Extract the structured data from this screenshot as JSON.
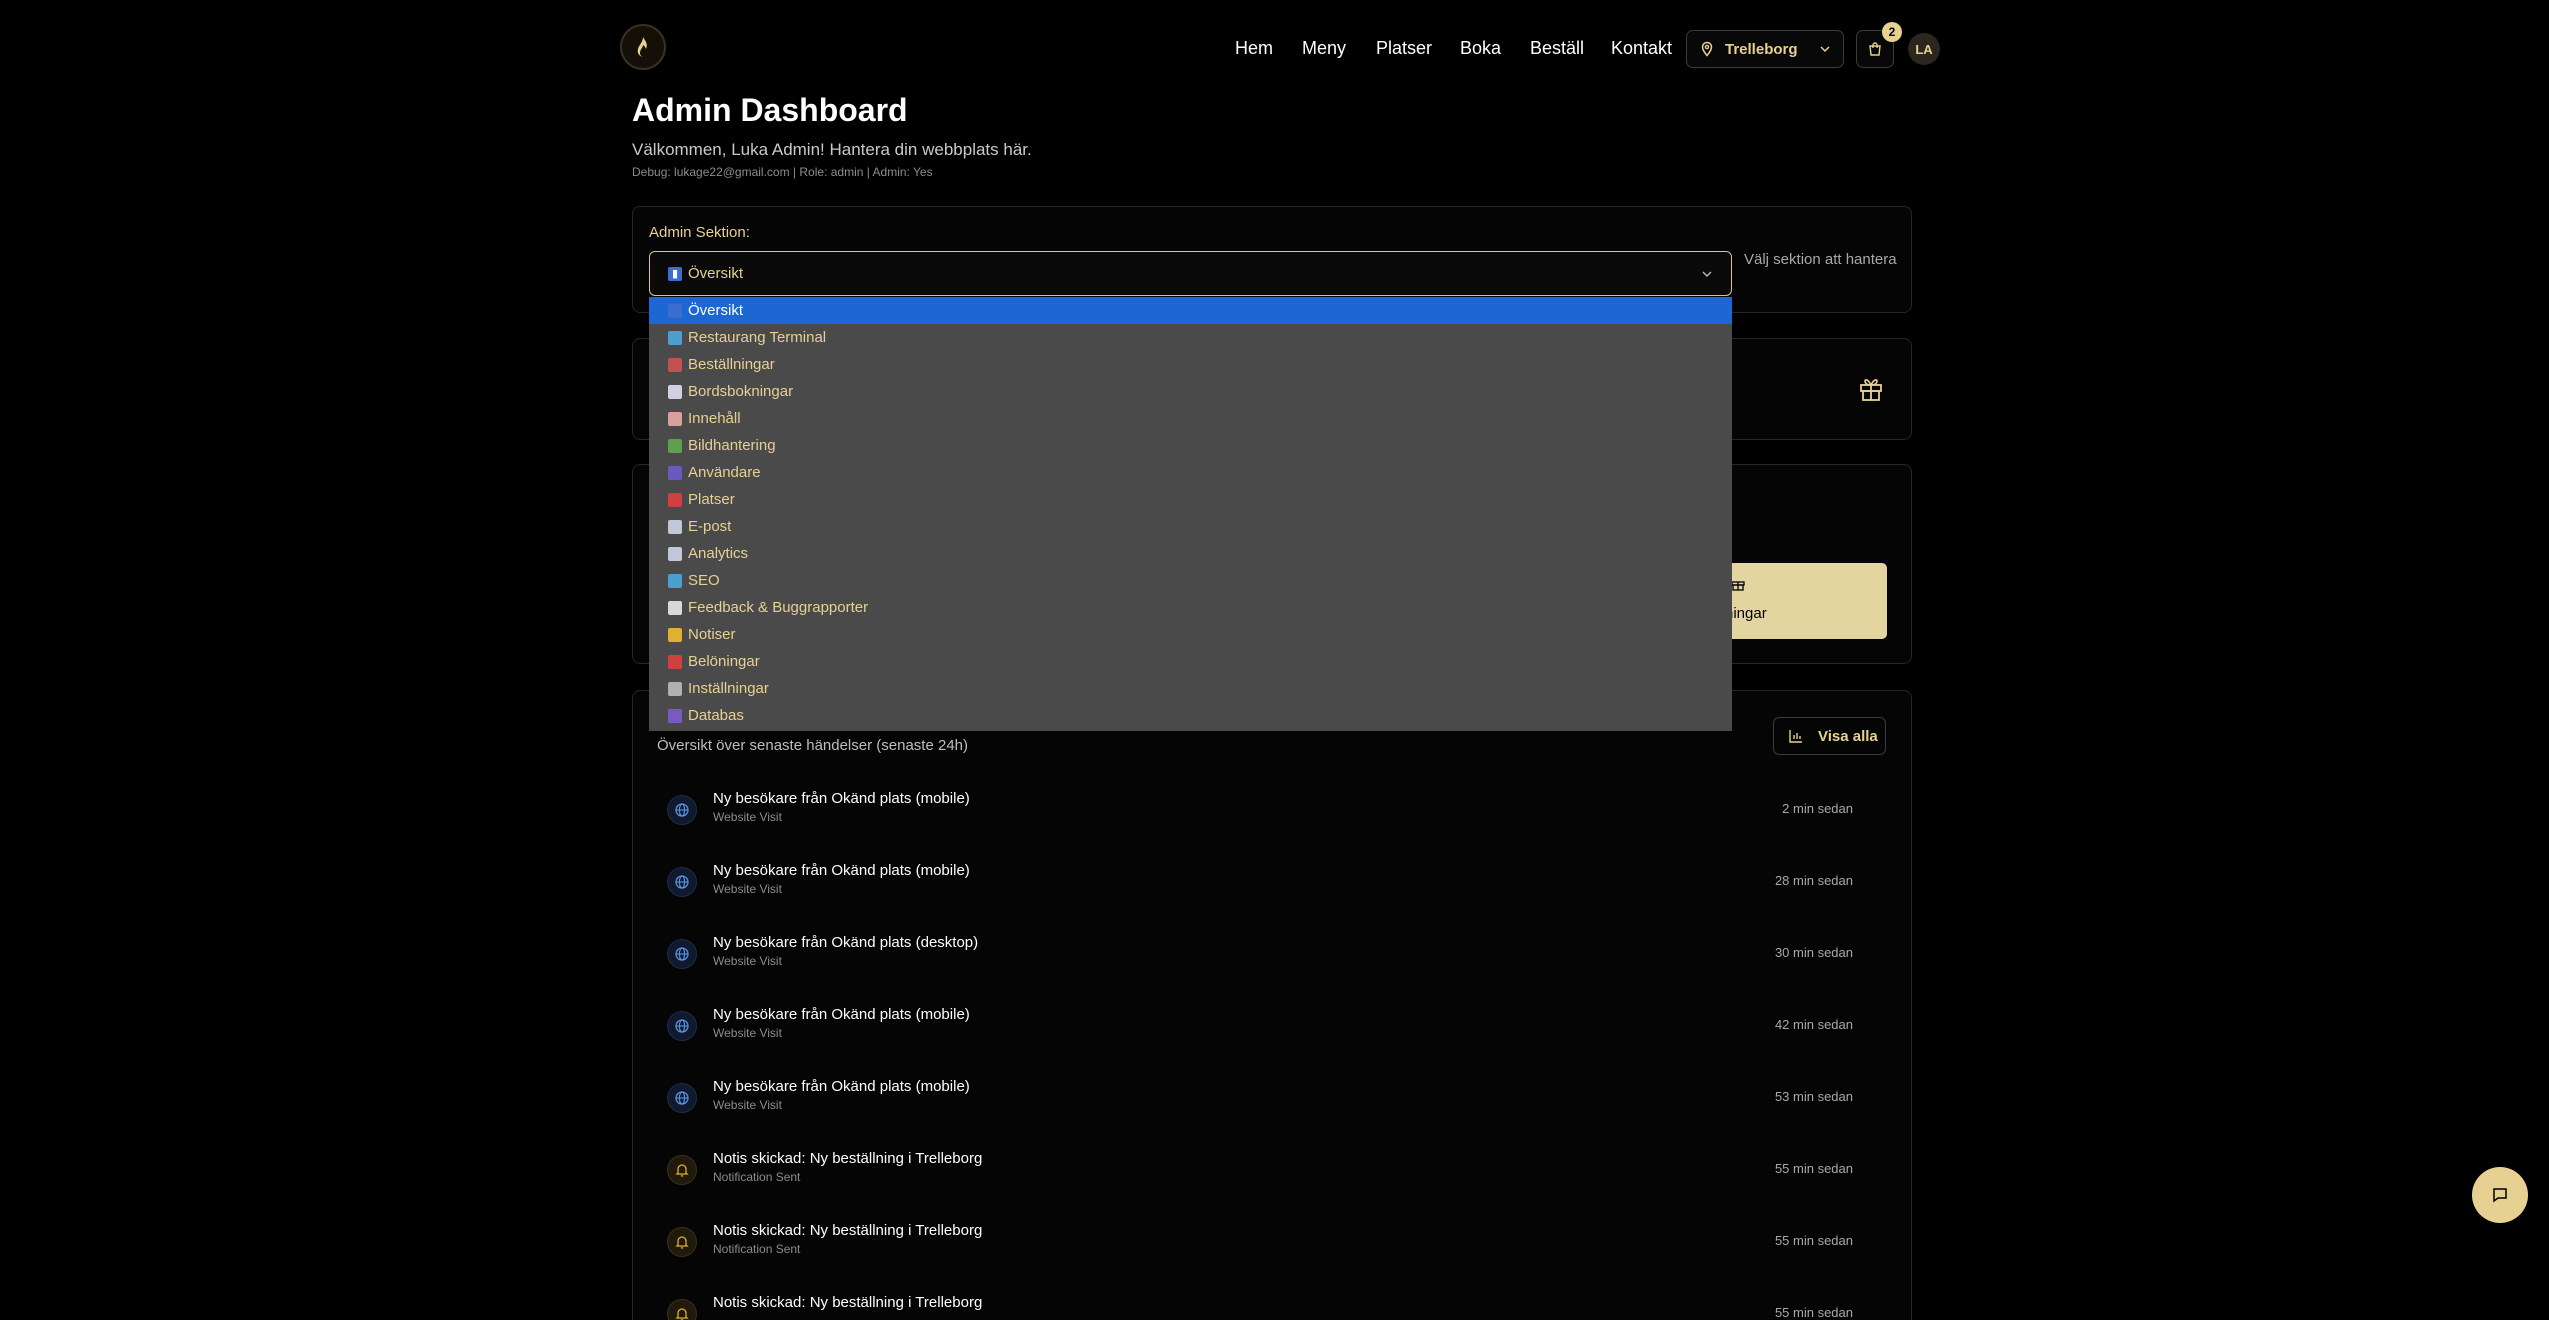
{
  "nav": {
    "links": [
      "Hem",
      "Meny",
      "Platser",
      "Boka",
      "Beställ",
      "Kontakt"
    ],
    "location": "Trelleborg",
    "cart_count": "2",
    "avatar_initials": "LA"
  },
  "header": {
    "title": "Admin Dashboard",
    "welcome": "Välkommen, Luka Admin! Hantera din webbplats här.",
    "debug": "Debug: lukage22@gmail.com | Role: admin | Admin: Yes"
  },
  "admin_section": {
    "label": "Admin Sektion:",
    "selected": "Översikt",
    "hint": "Välj sektion att hantera",
    "options": [
      {
        "emoji": "📊",
        "label": "Översikt",
        "color": "#3a6fd0"
      },
      {
        "emoji": "🖥",
        "label": "Restaurang Terminal",
        "color": "#4ba0d0"
      },
      {
        "emoji": "📦",
        "label": "Beställningar",
        "color": "#c2514f"
      },
      {
        "emoji": "📅",
        "label": "Bordsbokningar",
        "color": "#d0d0e0"
      },
      {
        "emoji": "📝",
        "label": "Innehåll",
        "color": "#d9a0a0"
      },
      {
        "emoji": "🖼",
        "label": "Bildhantering",
        "color": "#5fa04e"
      },
      {
        "emoji": "👥",
        "label": "Användare",
        "color": "#6a5ac0"
      },
      {
        "emoji": "📍",
        "label": "Platser",
        "color": "#d04040"
      },
      {
        "emoji": "📧",
        "label": "E-post",
        "color": "#c0c8d8"
      },
      {
        "emoji": "📈",
        "label": "Analytics",
        "color": "#c0c8d8"
      },
      {
        "emoji": "🔍",
        "label": "SEO",
        "color": "#4ba0d0"
      },
      {
        "emoji": "💬",
        "label": "Feedback & Buggrapporter",
        "color": "#d8d8d8"
      },
      {
        "emoji": "🔔",
        "label": "Notiser",
        "color": "#e0b030"
      },
      {
        "emoji": "🎁",
        "label": "Belöningar",
        "color": "#d04040"
      },
      {
        "emoji": "⚙",
        "label": "Inställningar",
        "color": "#b0b0b0"
      },
      {
        "emoji": "🗄",
        "label": "Databas",
        "color": "#7a5ac0"
      }
    ]
  },
  "rewards_button_partial": "ningar",
  "activity": {
    "subtitle": "Översikt över senaste händelser (senaste 24h)",
    "view_all": "Visa alla",
    "items": [
      {
        "icon": "globe",
        "title": "Ny besökare från Okänd plats (mobile)",
        "type": "Website Visit",
        "time": "2 min sedan"
      },
      {
        "icon": "globe",
        "title": "Ny besökare från Okänd plats (mobile)",
        "type": "Website Visit",
        "time": "28 min sedan"
      },
      {
        "icon": "globe",
        "title": "Ny besökare från Okänd plats (desktop)",
        "type": "Website Visit",
        "time": "30 min sedan"
      },
      {
        "icon": "globe",
        "title": "Ny besökare från Okänd plats (mobile)",
        "type": "Website Visit",
        "time": "42 min sedan"
      },
      {
        "icon": "globe",
        "title": "Ny besökare från Okänd plats (mobile)",
        "type": "Website Visit",
        "time": "53 min sedan"
      },
      {
        "icon": "bell",
        "title": "Notis skickad: Ny beställning i Trelleborg",
        "type": "Notification Sent",
        "time": "55 min sedan"
      },
      {
        "icon": "bell",
        "title": "Notis skickad: Ny beställning i Trelleborg",
        "type": "Notification Sent",
        "time": "55 min sedan"
      },
      {
        "icon": "bell",
        "title": "Notis skickad: Ny beställning i Trelleborg",
        "type": "",
        "time": "55 min sedan"
      }
    ]
  },
  "colors": {
    "accent": "#e7d192",
    "selected": "#1c67d3"
  }
}
